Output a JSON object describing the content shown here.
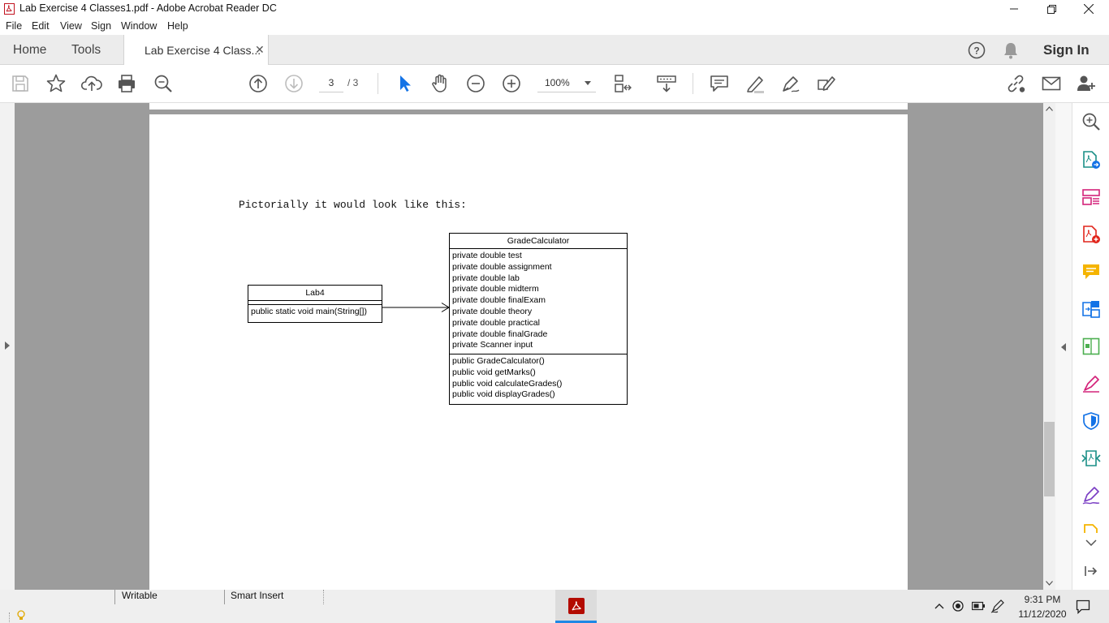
{
  "window": {
    "title": "Lab Exercise 4 Classes1.pdf - Adobe Acrobat Reader DC"
  },
  "menu": [
    "File",
    "Edit",
    "View",
    "Sign",
    "Window",
    "Help"
  ],
  "tabs": {
    "home": "Home",
    "tools": "Tools",
    "document": "Lab Exercise 4 Class...",
    "sign_in": "Sign In"
  },
  "toolbar": {
    "page_current": "3",
    "page_total": "/ 3",
    "zoom": "100%"
  },
  "document": {
    "intro_text": "Pictorially it would look like this:",
    "class_lab4": {
      "name": "Lab4",
      "methods": "public static void main(String[])"
    },
    "class_grade": {
      "name": "GradeCalculator",
      "fields": [
        "private double test",
        "private double assignment",
        "private double lab",
        "private double midterm",
        "private double finalExam",
        "private double theory",
        "private double practical",
        "private double finalGrade",
        "private Scanner input"
      ],
      "methods": [
        "public GradeCalculator()",
        "public void getMarks()",
        "public void calculateGrades()",
        "public void displayGrades()"
      ]
    }
  },
  "status": {
    "writable": "Writable",
    "smart_insert": "Smart Insert"
  },
  "taskbar": {
    "time": "9:31 PM",
    "date": "11/12/2020"
  },
  "colors": {
    "accent_red": "#c1121f",
    "select_blue": "#1473e6",
    "signin": "#333333"
  }
}
